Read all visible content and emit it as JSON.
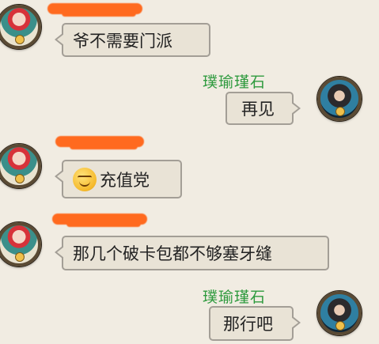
{
  "messages": [
    {
      "side": "left",
      "text": "爷不需要门派"
    },
    {
      "side": "right",
      "sender": "璞瑜瑾石",
      "text": "再见"
    },
    {
      "side": "left",
      "text": "充值党",
      "emoji": "grinning-emoji"
    },
    {
      "side": "left",
      "text": "那几个破卡包都不够塞牙缝"
    },
    {
      "side": "right",
      "sender": "璞瑜瑾石",
      "text": "那行吧"
    }
  ],
  "colors": {
    "background": "#f1ece2",
    "bubble": "#e9e3d6",
    "bubble_border": "#a39e96",
    "sender_name": "#2e9a3e",
    "redaction": "#ff6a1f"
  }
}
